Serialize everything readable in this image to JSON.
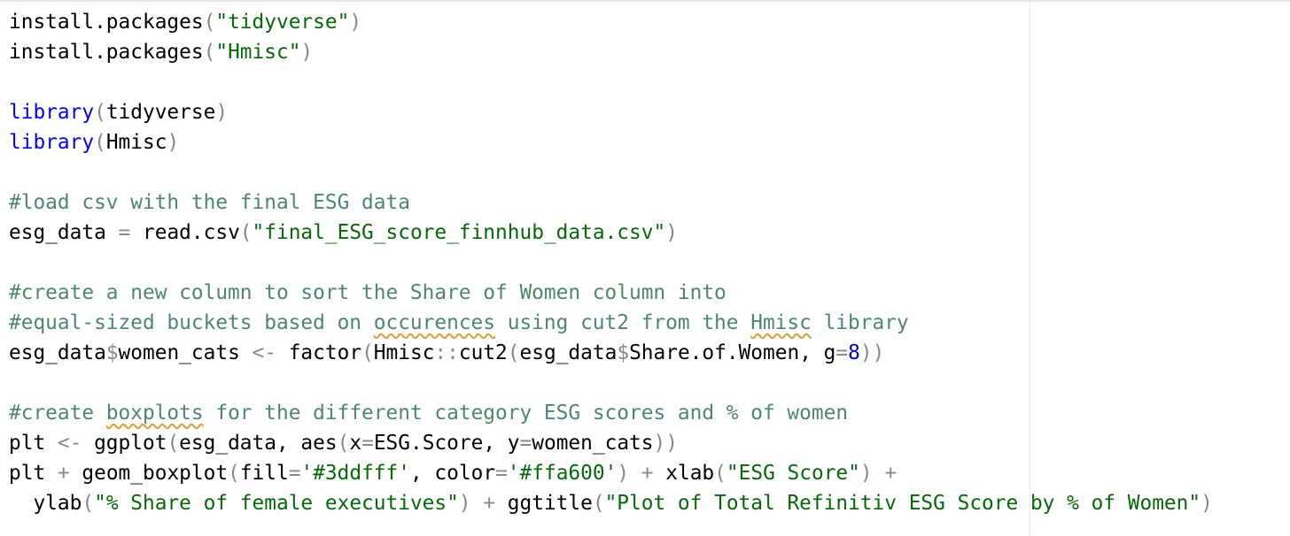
{
  "lines": [
    [
      "install.packages",
      "(",
      "\"tidyverse\"",
      ")"
    ],
    [
      "install.packages",
      "(",
      "\"Hmisc\"",
      ")"
    ],
    [],
    [
      "library",
      "(",
      "tidyverse",
      ")"
    ],
    [
      "library",
      "(",
      "Hmisc",
      ")"
    ],
    [],
    [
      "#load csv with the final ESG data"
    ],
    [
      "esg_data ",
      "=",
      " read.csv",
      "(",
      "\"final_ESG_score_finnhub_data.csv\"",
      ")"
    ],
    [],
    [
      "#create a new column to sort the Share of Women column into"
    ],
    [
      "#equal-sized buckets based on ",
      "occurences",
      " using cut2 from the ",
      "Hmisc",
      " library"
    ],
    [
      "esg_data",
      "$",
      "women_cats ",
      "<-",
      " factor",
      "(",
      "Hmisc",
      "::",
      "cut2",
      "(",
      "esg_data",
      "$",
      "Share.of.Women, g",
      "=",
      "8",
      "))"
    ],
    [],
    [
      "#create ",
      "boxplots",
      " for the different category ESG scores and % of women"
    ],
    [
      "plt ",
      "<-",
      " ggplot",
      "(",
      "esg_data, aes",
      "(",
      "x",
      "=",
      "ESG.Score, y",
      "=",
      "women_cats",
      "))"
    ],
    [
      "plt ",
      "+",
      " geom_boxplot",
      "(",
      "fill",
      "=",
      "'#3ddfff'",
      ", color",
      "=",
      "'#ffa600'",
      ")",
      " + ",
      "xlab",
      "(",
      "\"ESG Score\"",
      ")",
      " +"
    ],
    [
      "  ylab",
      "(",
      "\"% Share of female executives\"",
      ")",
      " + ",
      "ggtitle",
      "(",
      "\"Plot of Total Refinitiv ESG Score by % of Women\"",
      ")"
    ]
  ]
}
